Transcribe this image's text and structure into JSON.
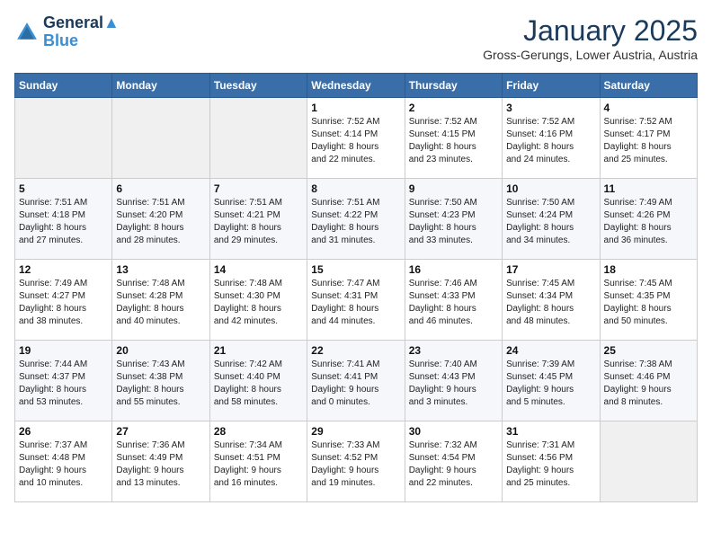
{
  "header": {
    "logo_line1": "General",
    "logo_line2": "Blue",
    "month": "January 2025",
    "location": "Gross-Gerungs, Lower Austria, Austria"
  },
  "days_of_week": [
    "Sunday",
    "Monday",
    "Tuesday",
    "Wednesday",
    "Thursday",
    "Friday",
    "Saturday"
  ],
  "weeks": [
    [
      {
        "day": "",
        "info": ""
      },
      {
        "day": "",
        "info": ""
      },
      {
        "day": "",
        "info": ""
      },
      {
        "day": "1",
        "info": "Sunrise: 7:52 AM\nSunset: 4:14 PM\nDaylight: 8 hours\nand 22 minutes."
      },
      {
        "day": "2",
        "info": "Sunrise: 7:52 AM\nSunset: 4:15 PM\nDaylight: 8 hours\nand 23 minutes."
      },
      {
        "day": "3",
        "info": "Sunrise: 7:52 AM\nSunset: 4:16 PM\nDaylight: 8 hours\nand 24 minutes."
      },
      {
        "day": "4",
        "info": "Sunrise: 7:52 AM\nSunset: 4:17 PM\nDaylight: 8 hours\nand 25 minutes."
      }
    ],
    [
      {
        "day": "5",
        "info": "Sunrise: 7:51 AM\nSunset: 4:18 PM\nDaylight: 8 hours\nand 27 minutes."
      },
      {
        "day": "6",
        "info": "Sunrise: 7:51 AM\nSunset: 4:20 PM\nDaylight: 8 hours\nand 28 minutes."
      },
      {
        "day": "7",
        "info": "Sunrise: 7:51 AM\nSunset: 4:21 PM\nDaylight: 8 hours\nand 29 minutes."
      },
      {
        "day": "8",
        "info": "Sunrise: 7:51 AM\nSunset: 4:22 PM\nDaylight: 8 hours\nand 31 minutes."
      },
      {
        "day": "9",
        "info": "Sunrise: 7:50 AM\nSunset: 4:23 PM\nDaylight: 8 hours\nand 33 minutes."
      },
      {
        "day": "10",
        "info": "Sunrise: 7:50 AM\nSunset: 4:24 PM\nDaylight: 8 hours\nand 34 minutes."
      },
      {
        "day": "11",
        "info": "Sunrise: 7:49 AM\nSunset: 4:26 PM\nDaylight: 8 hours\nand 36 minutes."
      }
    ],
    [
      {
        "day": "12",
        "info": "Sunrise: 7:49 AM\nSunset: 4:27 PM\nDaylight: 8 hours\nand 38 minutes."
      },
      {
        "day": "13",
        "info": "Sunrise: 7:48 AM\nSunset: 4:28 PM\nDaylight: 8 hours\nand 40 minutes."
      },
      {
        "day": "14",
        "info": "Sunrise: 7:48 AM\nSunset: 4:30 PM\nDaylight: 8 hours\nand 42 minutes."
      },
      {
        "day": "15",
        "info": "Sunrise: 7:47 AM\nSunset: 4:31 PM\nDaylight: 8 hours\nand 44 minutes."
      },
      {
        "day": "16",
        "info": "Sunrise: 7:46 AM\nSunset: 4:33 PM\nDaylight: 8 hours\nand 46 minutes."
      },
      {
        "day": "17",
        "info": "Sunrise: 7:45 AM\nSunset: 4:34 PM\nDaylight: 8 hours\nand 48 minutes."
      },
      {
        "day": "18",
        "info": "Sunrise: 7:45 AM\nSunset: 4:35 PM\nDaylight: 8 hours\nand 50 minutes."
      }
    ],
    [
      {
        "day": "19",
        "info": "Sunrise: 7:44 AM\nSunset: 4:37 PM\nDaylight: 8 hours\nand 53 minutes."
      },
      {
        "day": "20",
        "info": "Sunrise: 7:43 AM\nSunset: 4:38 PM\nDaylight: 8 hours\nand 55 minutes."
      },
      {
        "day": "21",
        "info": "Sunrise: 7:42 AM\nSunset: 4:40 PM\nDaylight: 8 hours\nand 58 minutes."
      },
      {
        "day": "22",
        "info": "Sunrise: 7:41 AM\nSunset: 4:41 PM\nDaylight: 9 hours\nand 0 minutes."
      },
      {
        "day": "23",
        "info": "Sunrise: 7:40 AM\nSunset: 4:43 PM\nDaylight: 9 hours\nand 3 minutes."
      },
      {
        "day": "24",
        "info": "Sunrise: 7:39 AM\nSunset: 4:45 PM\nDaylight: 9 hours\nand 5 minutes."
      },
      {
        "day": "25",
        "info": "Sunrise: 7:38 AM\nSunset: 4:46 PM\nDaylight: 9 hours\nand 8 minutes."
      }
    ],
    [
      {
        "day": "26",
        "info": "Sunrise: 7:37 AM\nSunset: 4:48 PM\nDaylight: 9 hours\nand 10 minutes."
      },
      {
        "day": "27",
        "info": "Sunrise: 7:36 AM\nSunset: 4:49 PM\nDaylight: 9 hours\nand 13 minutes."
      },
      {
        "day": "28",
        "info": "Sunrise: 7:34 AM\nSunset: 4:51 PM\nDaylight: 9 hours\nand 16 minutes."
      },
      {
        "day": "29",
        "info": "Sunrise: 7:33 AM\nSunset: 4:52 PM\nDaylight: 9 hours\nand 19 minutes."
      },
      {
        "day": "30",
        "info": "Sunrise: 7:32 AM\nSunset: 4:54 PM\nDaylight: 9 hours\nand 22 minutes."
      },
      {
        "day": "31",
        "info": "Sunrise: 7:31 AM\nSunset: 4:56 PM\nDaylight: 9 hours\nand 25 minutes."
      },
      {
        "day": "",
        "info": ""
      }
    ]
  ]
}
